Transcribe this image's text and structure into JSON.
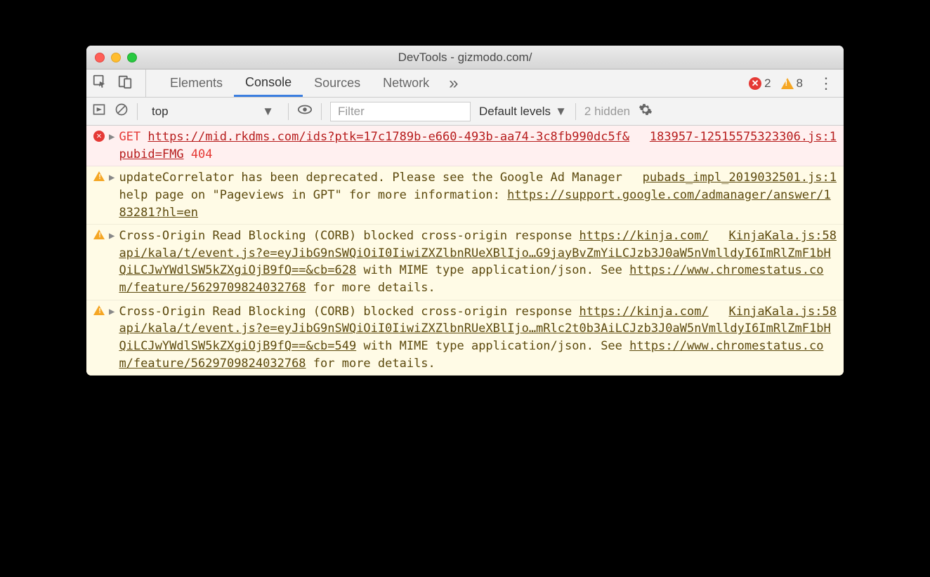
{
  "window": {
    "title": "DevTools - gizmodo.com/"
  },
  "tabs": {
    "items": [
      "Elements",
      "Console",
      "Sources",
      "Network"
    ],
    "active": "Console",
    "more": "»"
  },
  "counts": {
    "errors": "2",
    "warnings": "8"
  },
  "filterBar": {
    "context": "top",
    "filterPlaceholder": "Filter",
    "levels": "Default levels",
    "hidden": "2 hidden"
  },
  "logs": [
    {
      "type": "error",
      "method": "GET",
      "url": "https://mid.rkdms.com/ids?ptk=17c1789b-e660-493b-aa74-3c8fb990dc5f&pubid=FMG",
      "code": "404",
      "source": "183957-12515575323306.js:1"
    },
    {
      "type": "warn",
      "text1": "updateCorrelator has been deprecated. Please see the Google Ad Manager help page on \"Pageviews in GPT\" for more information: ",
      "link1": "https://support.google.com/admanager/answer/183281?hl=en",
      "source": "pubads_impl_2019032501.js:1"
    },
    {
      "type": "warn",
      "text1": "Cross-Origin Read Blocking (CORB) blocked cross-origin response ",
      "link1": "https://kinja.com/api/kala/t/event.js?e=eyJibG9nSWQiOiI0IiwiZXZlbnRUeXBlIjo…G9jayBvZmYiLCJzb3J0aW5nVmlldyI6ImRlZmF1bHQiLCJwYWdlSW5kZXgiOjB9fQ==&cb=628",
      "text2": " with MIME type application/json. See ",
      "link2": "https://www.chromestatus.com/feature/5629709824032768",
      "text3": " for more details.",
      "source": "KinjaKala.js:58"
    },
    {
      "type": "warn",
      "text1": "Cross-Origin Read Blocking (CORB) blocked cross-origin response ",
      "link1": "https://kinja.com/api/kala/t/event.js?e=eyJibG9nSWQiOiI0IiwiZXZlbnRUeXBlIjo…mRlc2t0b3AiLCJzb3J0aW5nVmlldyI6ImRlZmF1bHQiLCJwYWdlSW5kZXgiOjB9fQ==&cb=549",
      "text2": " with MIME type application/json. See ",
      "link2": "https://www.chromestatus.com/feature/5629709824032768",
      "text3": " for more details.",
      "source": "KinjaKala.js:58"
    }
  ]
}
